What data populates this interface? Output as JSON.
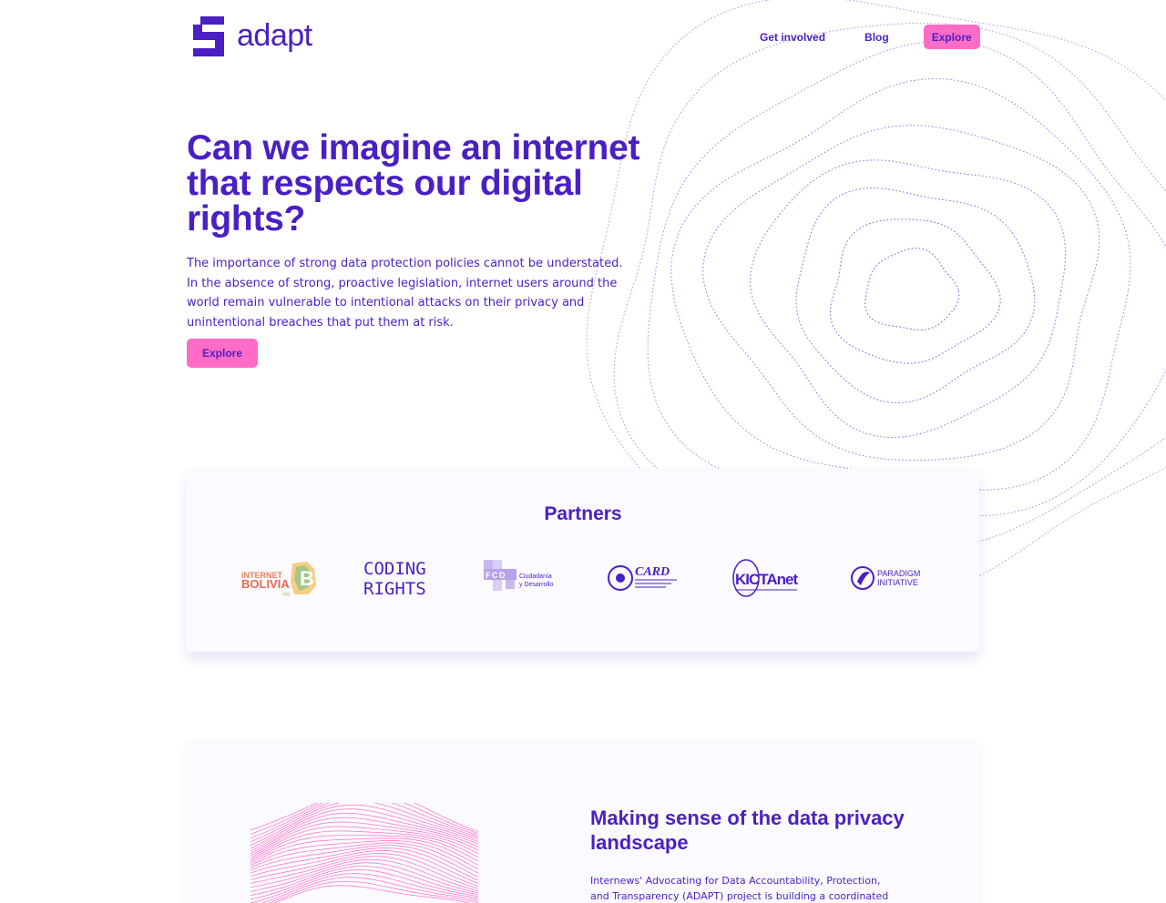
{
  "header": {
    "logo_text": "adapt",
    "nav": {
      "get_involved": "Get involved",
      "blog": "Blog",
      "explore": "Explore"
    }
  },
  "hero": {
    "title": "Can we imagine an internet that respects our digital rights?",
    "body": "The importance of strong data protection policies cannot be understated. In the absence of strong, proactive legislation, internet users around the world remain vulnerable to intentional attacks on their privacy and unintentional breaches that put them at risk.",
    "cta": "Explore"
  },
  "partners": {
    "title": "Partners",
    "logos": [
      {
        "name": "Internet Bolivia",
        "line1": "INTERNET",
        "line2": "BOLIVIA",
        "mark": "B",
        "tag": ".org"
      },
      {
        "name": "Coding Rights",
        "line1": "CODING",
        "line2": "RIGHTS"
      },
      {
        "name": "Fundación Ciudadanía y Desarrollo",
        "mark": "FCD",
        "line1": "Ciudadanía",
        "line2": "y Desarrollo"
      },
      {
        "name": "CARD",
        "line1": "CARD"
      },
      {
        "name": "KICTAnet",
        "line1": "KICTAnet"
      },
      {
        "name": "Paradigm Initiative",
        "line1": "PARADIGM",
        "line2": "INITIATIVE"
      }
    ]
  },
  "privacy": {
    "title": "Making sense of the data privacy landscape",
    "body": "Internews' Advocating for Data Accountability, Protection, and Transparency (ADAPT) project is building a coordinated advocacy"
  },
  "colors": {
    "brand": "#4a1fc4",
    "accent": "#ff6cc7",
    "card": "#fbfaff"
  }
}
